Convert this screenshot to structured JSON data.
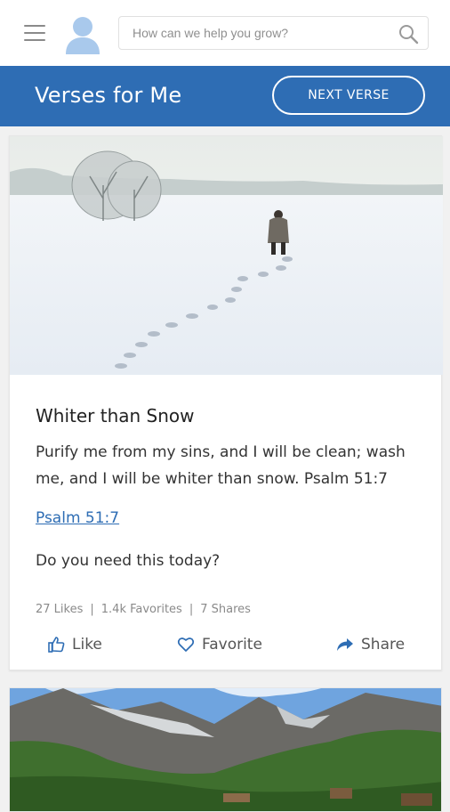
{
  "search": {
    "placeholder": "How can we help you grow?"
  },
  "header": {
    "title": "Verses for Me",
    "next_label": "NEXT VERSE"
  },
  "card": {
    "title": "Whiter than Snow",
    "text": "Purify me from my sins, and I will be clean; wash me, and I will be whiter than snow. Psalm 51:7",
    "reference": "Psalm 51:7",
    "question": "Do you need this today?",
    "stats": {
      "likes": "27 Likes",
      "sep1": "|",
      "favorites": "1.4k Favorites",
      "sep2": "|",
      "shares": "7 Shares"
    },
    "actions": {
      "like": "Like",
      "favorite": "Favorite",
      "share": "Share"
    }
  },
  "icons": {
    "menu": "hamburger-menu-icon",
    "avatar": "user-avatar-icon",
    "search": "search-icon",
    "like": "thumbs-up-icon",
    "favorite": "heart-icon",
    "share": "share-arrow-icon"
  },
  "colors": {
    "brand": "#2e6db4",
    "avatar": "#a9c9ec"
  }
}
